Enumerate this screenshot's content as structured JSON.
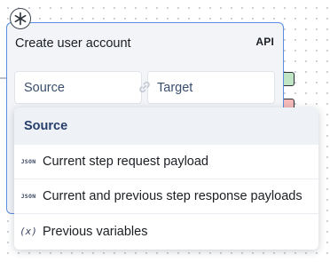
{
  "node": {
    "title": "Create user account",
    "tag": "API",
    "badge_icon": "asterisk-icon"
  },
  "mapping": {
    "source_label": "Source",
    "target_label": "Target",
    "link_icon": "link-icon"
  },
  "dropdown": {
    "header": "Source",
    "items": [
      {
        "icon_text": "JSON",
        "icon": "json-icon",
        "label": "Current step request payload"
      },
      {
        "icon_text": "JSON",
        "icon": "json-icon",
        "label": "Current and previous step response payloads"
      },
      {
        "icon_text": "(x)",
        "icon": "variable-icon",
        "label": "Previous variables"
      }
    ]
  },
  "colors": {
    "accent": "#5b8ee0",
    "success_port": "#bfe5c4",
    "error_port": "#f4b9b9",
    "header_text": "#253e6a"
  }
}
